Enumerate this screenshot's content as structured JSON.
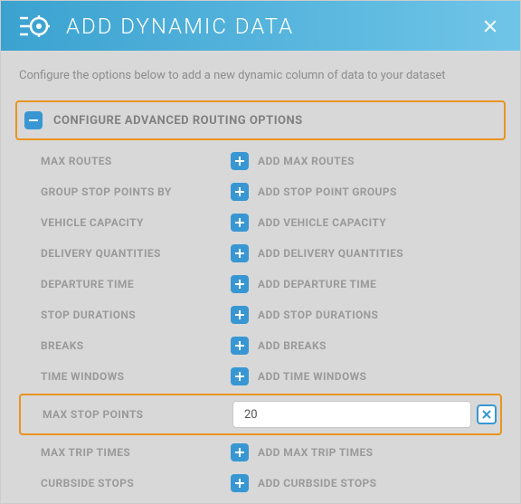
{
  "header": {
    "title": "ADD DYNAMIC DATA"
  },
  "subtitle": "Configure the options below to add a new dynamic column of data to your dataset",
  "section": {
    "title": "CONFIGURE ADVANCED ROUTING OPTIONS"
  },
  "rows": {
    "max_routes": {
      "label": "MAX ROUTES",
      "action": "ADD MAX ROUTES"
    },
    "group_stop": {
      "label": "GROUP STOP POINTS BY",
      "action": "ADD STOP POINT GROUPS"
    },
    "vehicle_cap": {
      "label": "VEHICLE CAPACITY",
      "action": "ADD VEHICLE CAPACITY"
    },
    "delivery_qty": {
      "label": "DELIVERY QUANTITIES",
      "action": "ADD DELIVERY QUANTITIES"
    },
    "departure": {
      "label": "DEPARTURE TIME",
      "action": "ADD DEPARTURE TIME"
    },
    "stop_dur": {
      "label": "STOP DURATIONS",
      "action": "ADD STOP DURATIONS"
    },
    "breaks": {
      "label": "BREAKS",
      "action": "ADD BREAKS"
    },
    "time_windows": {
      "label": "TIME WINDOWS",
      "action": "ADD TIME WINDOWS"
    },
    "max_stop_points": {
      "label": "MAX STOP POINTS",
      "value": "20"
    },
    "max_trip": {
      "label": "MAX TRIP TIMES",
      "action": "ADD MAX TRIP TIMES"
    },
    "curbside": {
      "label": "CURBSIDE STOPS",
      "action": "ADD CURBSIDE STOPS"
    }
  }
}
